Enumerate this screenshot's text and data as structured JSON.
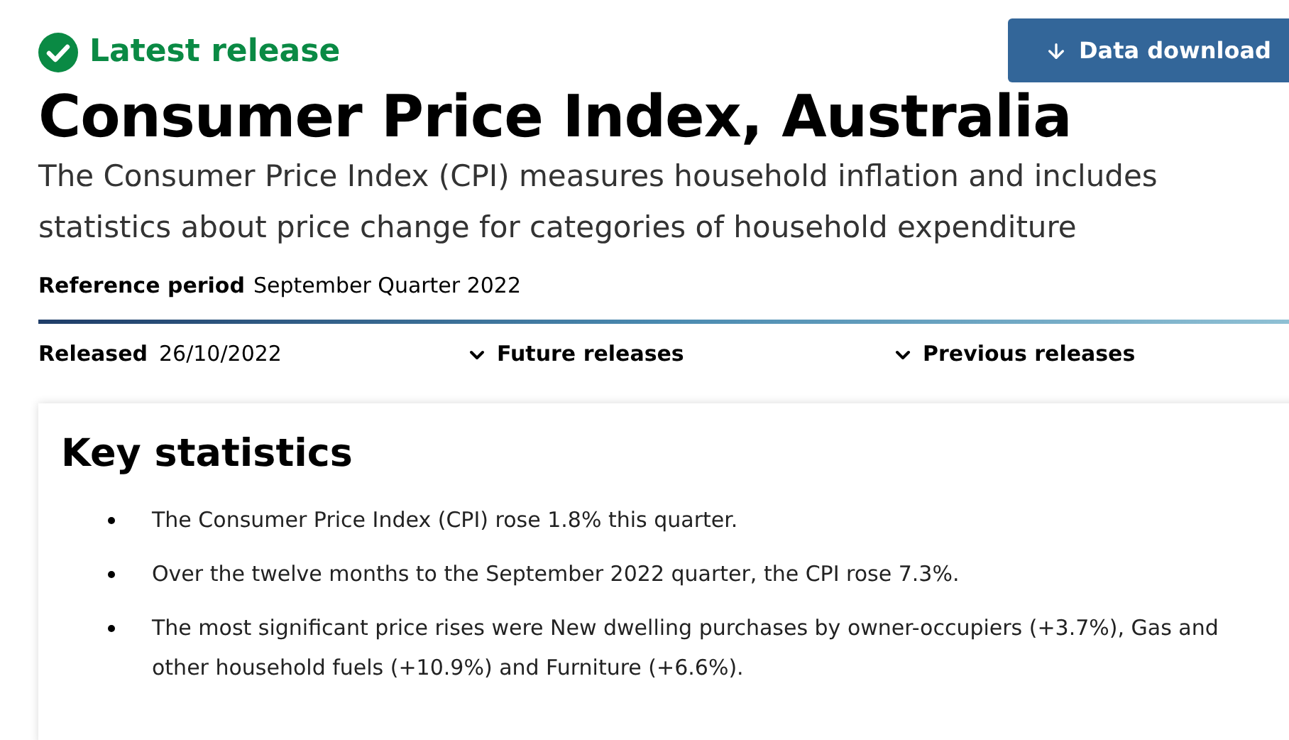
{
  "status": {
    "label": "Latest release"
  },
  "download_button": {
    "label": "Data download"
  },
  "title": "Consumer Price Index, Australia",
  "subtitle": "The Consumer Price Index (CPI) measures household inflation and includes statistics about price change for categories of household expenditure",
  "reference_period": {
    "label": "Reference period",
    "value": "September Quarter 2022"
  },
  "released": {
    "label": "Released",
    "value": "26/10/2022"
  },
  "release_links": [
    {
      "label": "Future releases",
      "expanded": false
    },
    {
      "label": "Previous releases",
      "expanded": false
    }
  ],
  "key_statistics": {
    "heading": "Key statistics",
    "items": [
      "The Consumer Price Index (CPI) rose 1.8% this quarter.",
      "Over the twelve months to the September 2022 quarter, the CPI rose 7.3%.",
      "The most significant price rises were New dwelling purchases by owner-occupiers (+3.7%), Gas and other household fuels (+10.9%) and Furniture (+6.6%)."
    ]
  }
}
